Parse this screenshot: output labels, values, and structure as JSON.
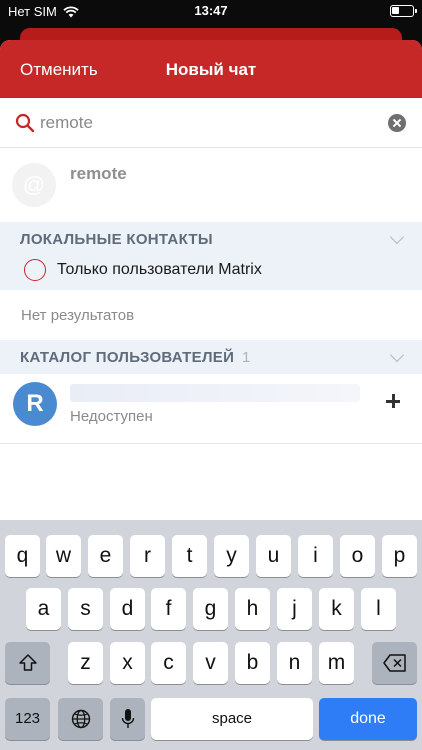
{
  "status": {
    "carrier": "Нет SIM",
    "time": "13:47"
  },
  "nav": {
    "cancel": "Отменить",
    "title": "Новый чат"
  },
  "search": {
    "query": "remote"
  },
  "suggestion": {
    "avatar": "@",
    "name": "remote"
  },
  "local_contacts": {
    "title": "ЛОКАЛЬНЫЕ КОНТАКТЫ",
    "filter_label": "Только пользователи Matrix",
    "empty": "Нет результатов"
  },
  "directory": {
    "title": "КАТАЛОГ ПОЛЬЗОВАТЕЛЕЙ",
    "count": "1",
    "user": {
      "initial": "R",
      "status": "Недоступен"
    }
  },
  "keyboard": {
    "row1": [
      "q",
      "w",
      "e",
      "r",
      "t",
      "y",
      "u",
      "i",
      "o",
      "p"
    ],
    "row2": [
      "a",
      "s",
      "d",
      "f",
      "g",
      "h",
      "j",
      "k",
      "l"
    ],
    "row3": [
      "z",
      "x",
      "c",
      "v",
      "b",
      "n",
      "m"
    ],
    "numbers": "123",
    "space": "space",
    "done": "done"
  }
}
